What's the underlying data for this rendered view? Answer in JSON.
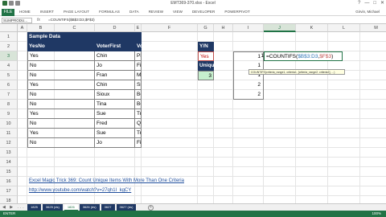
{
  "window": {
    "title": "EMT369-370.xlsx - Excel",
    "controls": [
      "?",
      "—",
      "□",
      "✕"
    ]
  },
  "ribbon": {
    "file_tab": "FILE",
    "tabs": [
      "HOME",
      "INSERT",
      "PAGE LAYOUT",
      "FORMULAS",
      "DATA",
      "REVIEW",
      "VIEW",
      "DEVELOPER",
      "POWERPIVOT"
    ],
    "user": "Girvin, Michael"
  },
  "formula_bar": {
    "name_box": "SUMPRODU...",
    "fx_label": "fx",
    "formula": "=COUNTIFS($B$3:D3,$F$3)"
  },
  "columns": [
    "A",
    "B",
    "C",
    "D",
    "E",
    "F",
    "G",
    "H",
    "I",
    "J",
    "K",
    "L",
    "M"
  ],
  "rows": [
    "1",
    "2",
    "3",
    "4",
    "5",
    "6",
    "7",
    "8",
    "9",
    "10",
    "11",
    "12",
    "13",
    "14",
    "15",
    "16",
    "17",
    "18"
  ],
  "table": {
    "title": "Sample Data",
    "headers": [
      "YesNo",
      "VoterFirst",
      "VoterLast"
    ],
    "rows": [
      [
        "Yes",
        "Chin",
        "Pham"
      ],
      [
        "No",
        "Jo",
        "Finn"
      ],
      [
        "No",
        "Fran",
        "Mount"
      ],
      [
        "Yes",
        "Chin",
        "Smith"
      ],
      [
        "No",
        "Sioux",
        "Boxer"
      ],
      [
        "No",
        "Tina",
        "Boxer"
      ],
      [
        "Yes",
        "Sue",
        "Tran"
      ],
      [
        "No",
        "Fred",
        "Quin"
      ],
      [
        "Yes",
        "Sue",
        "Tran"
      ],
      [
        "No",
        "Jo",
        "Finn"
      ]
    ]
  },
  "criteria": {
    "yn_label": "Y/N",
    "yn_value": "Yes",
    "unique_label": "Unique Records",
    "unique_value": "3"
  },
  "helper": {
    "values": [
      "1",
      "1",
      "1",
      "2",
      "2"
    ],
    "edit_value": "1",
    "edit_formula_prefix": "=COUNTIFS(",
    "edit_formula_ref1": "$B$3:D3",
    "edit_formula_sep": ",",
    "edit_formula_ref2": "$F$3",
    "edit_formula_suffix": ")",
    "tooltip": "COUNTIFS(criteria_range1, criteria1, [criteria_range2, criteria2], ...)"
  },
  "links": {
    "title": "Excel Magic Trick 369: Count Unique Items With More Than One Criteria",
    "url": "http://www.youtube.com/watch?v=27qh1I_kgCY"
  },
  "sheet_tabs": {
    "nav": "◀ ▶ ...",
    "tabs": [
      "1825",
      "3625 (ds)",
      "1826",
      "3626 (ds)",
      "3627",
      "3627 (ds)"
    ],
    "active_index": 2,
    "add": "+"
  },
  "status": {
    "mode": "ENTER",
    "zoom": "100%"
  },
  "colors": {
    "excel_green": "#217346",
    "table_header": "#1f3864",
    "unique_fill": "#c6efce",
    "link": "#1f4e9c"
  }
}
